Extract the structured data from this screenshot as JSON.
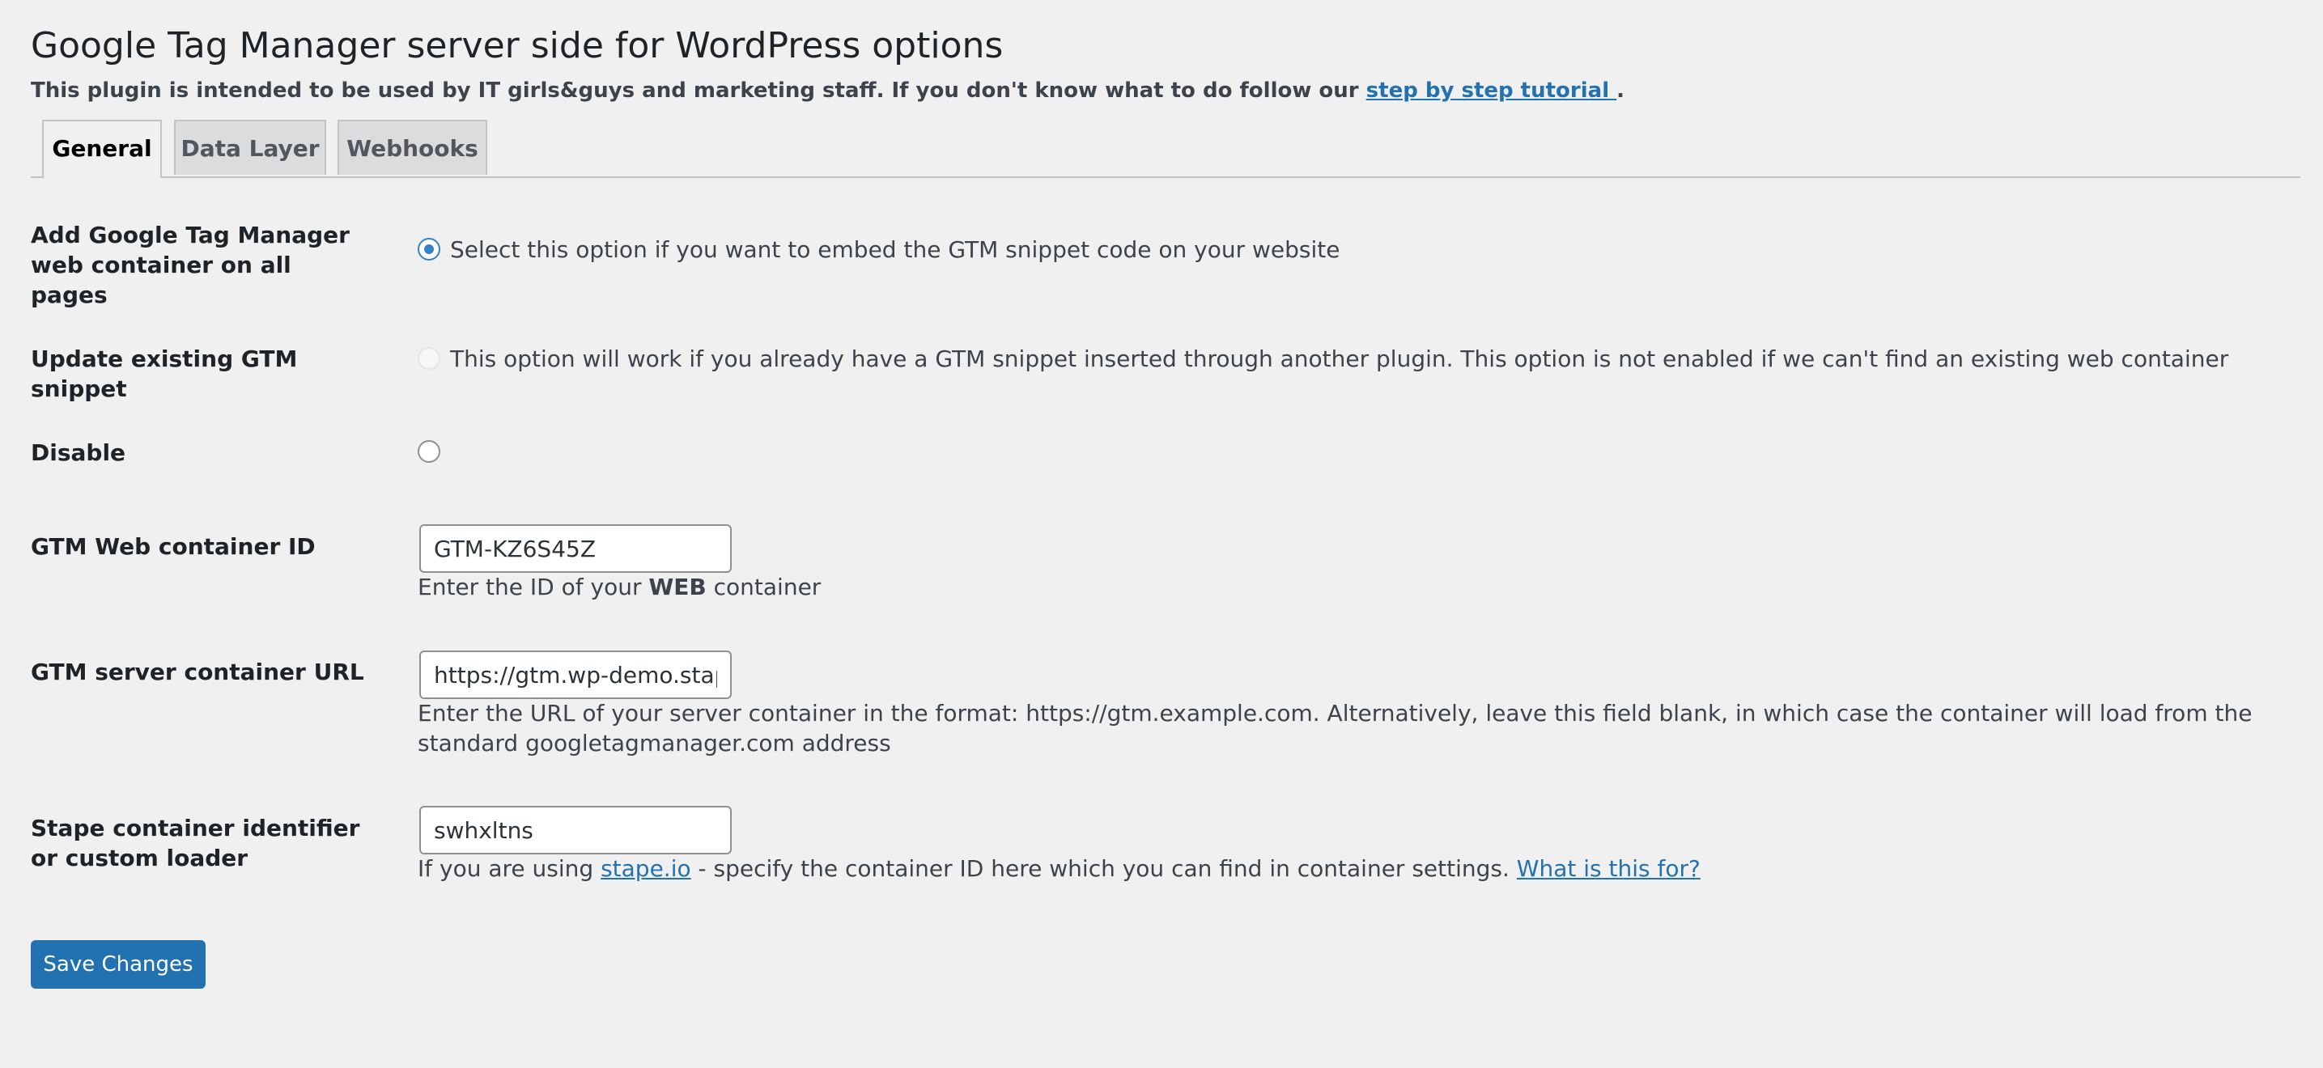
{
  "page": {
    "title": "Google Tag Manager server side for WordPress options",
    "intro_text": "This plugin is intended to be used by IT girls&guys and marketing staff. If you don't know what to do follow our ",
    "intro_link": "step by step tutorial ",
    "intro_end": "."
  },
  "tabs": [
    {
      "label": "General",
      "active": true
    },
    {
      "label": "Data Layer",
      "active": false
    },
    {
      "label": "Webhooks",
      "active": false
    }
  ],
  "form": {
    "placement": {
      "add_label": "Add Google Tag Manager web container on all pages",
      "add_text": "Select this option if you want to embed the GTM snippet code on your website",
      "update_label": "Update existing GTM snippet",
      "update_text": "This option will work if you already have a GTM snippet inserted through another plugin. This option is not enabled if we can't find an existing web container",
      "disable_label": "Disable",
      "selected": "add"
    },
    "web_container_id": {
      "label": "GTM Web container ID",
      "value": "GTM-KZ6S45Z",
      "desc_before": "Enter the ID of your ",
      "desc_bold": "WEB",
      "desc_after": " container"
    },
    "server_container_url": {
      "label": "GTM server container URL",
      "value": "https://gtm.wp-demo.stape.io",
      "desc": "Enter the URL of your server container in the format: https://gtm.example.com. Alternatively, leave this field blank, in which case the container will load from the standard googletagmanager.com address"
    },
    "stape_identifier": {
      "label": "Stape container identifier or custom loader",
      "value": "swhxltns",
      "desc_before": "If you are using ",
      "desc_link": "stape.io",
      "desc_middle": " - specify the container ID here which you can find in container settings. ",
      "help_link": "What is this for?"
    }
  },
  "save_label": "Save Changes",
  "colors": {
    "background": "#f0f0f1",
    "link": "#2271b1",
    "button": "#2271b1",
    "radio_checked": "#3582c4"
  }
}
